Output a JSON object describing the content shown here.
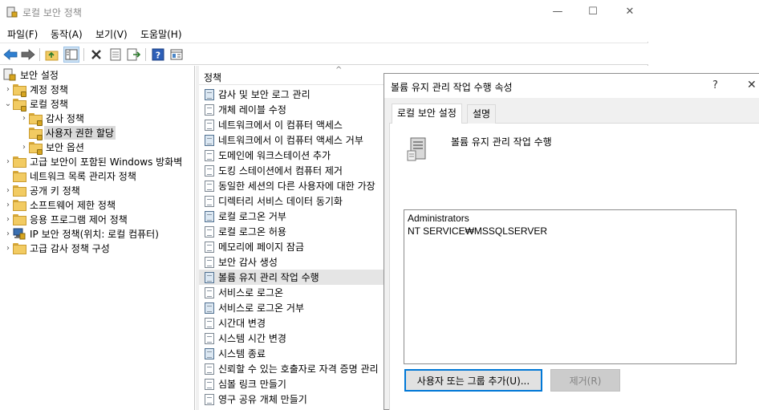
{
  "window": {
    "title": "로컬 보안 정책",
    "minimize": "—",
    "maximize": "☐",
    "close": "✕"
  },
  "menu": {
    "items": [
      "파일(F)",
      "동작(A)",
      "보기(V)",
      "도움말(H)"
    ]
  },
  "toolbar": {
    "icons": [
      "back-icon",
      "forward-icon",
      "up-folder-icon",
      "show-hide-tree-icon",
      "delete-icon",
      "properties-icon",
      "export-icon",
      "help-icon",
      "details-view-icon"
    ]
  },
  "tree": {
    "items": [
      {
        "label": "보안 설정",
        "level": 0,
        "expander": ""
      },
      {
        "label": "계정 정책",
        "level": 1,
        "expander": "›"
      },
      {
        "label": "로컬 정책",
        "level": 1,
        "expander": "⌄"
      },
      {
        "label": "감사 정책",
        "level": 2,
        "expander": "›"
      },
      {
        "label": "사용자 권한 할당",
        "level": 2,
        "expander": "",
        "selected": true
      },
      {
        "label": "보안 옵션",
        "level": 2,
        "expander": "›"
      },
      {
        "label": "고급 보안이 포함된 Windows 방화벽",
        "level": 1,
        "expander": "›"
      },
      {
        "label": "네트워크 목록 관리자 정책",
        "level": 1,
        "expander": ""
      },
      {
        "label": "공개 키 정책",
        "level": 1,
        "expander": "›"
      },
      {
        "label": "소프트웨어 제한 정책",
        "level": 1,
        "expander": "›"
      },
      {
        "label": "응용 프로그램 제어 정책",
        "level": 1,
        "expander": "›"
      },
      {
        "label": "IP 보안 정책(위치: 로컬 컴퓨터)",
        "level": 1,
        "expander": "›"
      },
      {
        "label": "고급 감사 정책 구성",
        "level": 1,
        "expander": "›"
      }
    ]
  },
  "list": {
    "column_header": "정책",
    "sort_indicator": "^",
    "items": [
      {
        "label": "감사 및 보안 로그 관리",
        "icon": "blue"
      },
      {
        "label": "개체 레이블 수정",
        "icon": "plain"
      },
      {
        "label": "네트워크에서 이 컴퓨터 액세스",
        "icon": "plain"
      },
      {
        "label": "네트워크에서 이 컴퓨터 액세스 거부",
        "icon": "blue"
      },
      {
        "label": "도메인에 워크스테이션 추가",
        "icon": "plain"
      },
      {
        "label": "도킹 스테이션에서 컴퓨터 제거",
        "icon": "plain"
      },
      {
        "label": "동일한 세션의 다른 사용자에 대한 가장",
        "icon": "plain"
      },
      {
        "label": "디렉터리 서비스 데이터 동기화",
        "icon": "plain"
      },
      {
        "label": "로컬 로그온 거부",
        "icon": "blue"
      },
      {
        "label": "로컬 로그온 허용",
        "icon": "plain"
      },
      {
        "label": "메모리에 페이지 잠금",
        "icon": "plain"
      },
      {
        "label": "보안 감사 생성",
        "icon": "plain"
      },
      {
        "label": "볼륨 유지 관리 작업 수행",
        "icon": "blue",
        "selected": true
      },
      {
        "label": "서비스로 로그온",
        "icon": "plain"
      },
      {
        "label": "서비스로 로그온 거부",
        "icon": "blue"
      },
      {
        "label": "시간대 변경",
        "icon": "plain"
      },
      {
        "label": "시스템 시간 변경",
        "icon": "plain"
      },
      {
        "label": "시스템 종료",
        "icon": "blue"
      },
      {
        "label": "신뢰할 수 있는 호출자로 자격 증명 관리",
        "icon": "plain"
      },
      {
        "label": "심볼 링크 만들기",
        "icon": "plain"
      },
      {
        "label": "영구 공유 개체 만들기",
        "icon": "plain"
      }
    ]
  },
  "dialog": {
    "title": "볼륨 유지 관리 작업 수행 속성",
    "help": "?",
    "close": "✕",
    "tabs": [
      "로컬 보안 설정",
      "설명"
    ],
    "policy_name": "볼륨 유지 관리 작업 수행",
    "members": [
      "Administrators",
      "NT SERVICE₩MSSQLSERVER"
    ],
    "add_button": "사용자 또는 그룹 추가(U)...",
    "remove_button": "제거(R)"
  }
}
